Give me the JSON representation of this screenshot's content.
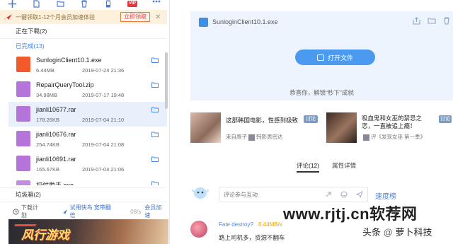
{
  "toolbar": {
    "icons": [
      "add-icon",
      "new-file-icon",
      "folder-icon",
      "trash-icon",
      "mobile-icon",
      "vip-icon",
      "more-icon"
    ],
    "vip_label": "VIP"
  },
  "promo": {
    "text": "一键领取1-12个月会员加速体验",
    "button": "立即领取",
    "close": "✕"
  },
  "sections": {
    "downloading": "正在下载(2)",
    "completed": "已完成(13)",
    "trash": "垃圾箱(2)"
  },
  "files": [
    {
      "name": "SunloginClient10.1.exe",
      "size": "6.44MB",
      "date": "2019-07-24 21:36",
      "icon": "sunlogin-icon",
      "color": "#f25a2c",
      "selected": false
    },
    {
      "name": "RepairQueryTool.zip",
      "size": "34.98MB",
      "date": "2019-07-17 19:48",
      "icon": "zip-archive-icon",
      "color": "#b574d9",
      "selected": false
    },
    {
      "name": "jianli10677.rar",
      "size": "178.26KB",
      "date": "2019-07-04 21:10",
      "icon": "rar-archive-icon",
      "color": "#b574d9",
      "selected": true
    },
    {
      "name": "jianli10676.rar",
      "size": "254.74KB",
      "date": "2019-07-04 21:08",
      "icon": "rar-archive-icon",
      "color": "#b574d9",
      "selected": false
    },
    {
      "name": "jianli10691.rar",
      "size": "165.67KB",
      "date": "2019-07-04 21:06",
      "icon": "rar-archive-icon",
      "color": "#b574d9",
      "selected": false
    },
    {
      "name": "初仗助手.exe",
      "size": "",
      "date": "",
      "icon": "exe-icon",
      "color": "#c48be0",
      "selected": false
    }
  ],
  "bottom": {
    "plan": "下载计划",
    "fast": "试用快鸟 宽带翻倍",
    "speed": "08/s",
    "vip_accel": "会员加速"
  },
  "banner": {
    "title": "风行游戏"
  },
  "detail": {
    "filename": "SunloginClient10.1.exe",
    "open_button": "打开文件",
    "congrats": "恭喜你，解锁“秒下”成就"
  },
  "feed": {
    "cards": [
      {
        "title": "这部韩国电影，性感到极致",
        "tag": "讨论",
        "author": "来自厕子",
        "author2": "韩影思密达"
      },
      {
        "title": "吸血鬼和女巫的禁忌之恋，一直被追上瘾！",
        "tag": "",
        "author": "评《发现女巫 第一季》"
      }
    ],
    "side_tag": "讨论"
  },
  "tabs": {
    "comments": "评论(12)",
    "properties": "属性详情"
  },
  "comment_box": {
    "placeholder": "评论参与互动"
  },
  "speed_rank": "速度榜",
  "comment": {
    "user": "Fate destroy?",
    "speed": "6.44MB/s",
    "text": "路上司机多，资源不翻车"
  },
  "watermark": {
    "text": "www.rjtj.cn软荐网",
    "sub_prefix": "头条",
    "sub_at": "@",
    "sub_name": "萝卜科技"
  },
  "colors": {
    "accent": "#4a86e8",
    "promo_bg": "#fdf1dc",
    "detail_bg": "#eef4fd",
    "open_button": "#4b9af0"
  }
}
